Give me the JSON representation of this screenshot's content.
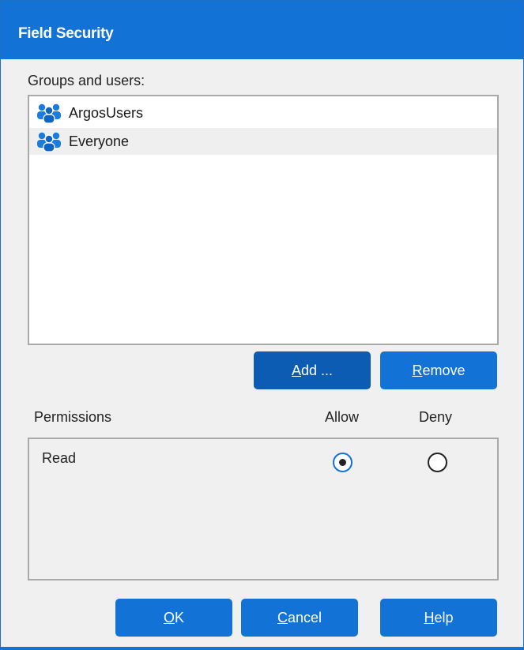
{
  "window": {
    "title": "Field Security"
  },
  "groups": {
    "label": "Groups and users:",
    "items": [
      {
        "name": "ArgosUsers",
        "icon": "users-group-icon"
      },
      {
        "name": "Everyone",
        "icon": "users-group-icon"
      }
    ]
  },
  "buttons": {
    "add": {
      "mnemonic": "A",
      "rest": "dd ..."
    },
    "remove": {
      "mnemonic": "R",
      "rest": "emove"
    },
    "ok": {
      "mnemonic": "O",
      "rest": "K"
    },
    "cancel": {
      "mnemonic": "C",
      "rest": "ancel"
    },
    "help": {
      "mnemonic": "H",
      "rest": "elp"
    }
  },
  "permissions": {
    "header": "Permissions",
    "allow_header": "Allow",
    "deny_header": "Deny",
    "rows": [
      {
        "name": "Read",
        "allow": true,
        "deny": false
      }
    ]
  },
  "colors": {
    "accent": "#1272d6",
    "accent_dark": "#0b5cb2",
    "border": "#a9a9a9"
  }
}
